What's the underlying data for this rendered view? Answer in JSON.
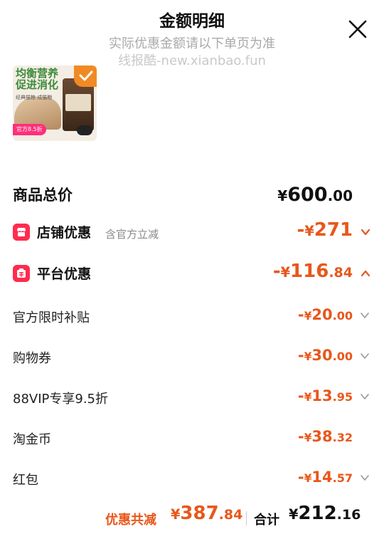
{
  "header": {
    "title": "金额明细",
    "subtitle": "实际优惠金额请以下单页为准",
    "watermark": "线报酷-new.xianbao.fun"
  },
  "product": {
    "image_text": "均衡营养 促进消化",
    "image_small_text": "经典猫粮·成猫粮",
    "badge": "官方8.5折"
  },
  "total": {
    "label": "商品总价",
    "currency": "¥",
    "int": "600",
    "dec": ".00"
  },
  "shop_discount": {
    "label": "店铺优惠",
    "note": "含官方立减",
    "sign": "-",
    "currency": "¥",
    "int": "271",
    "dec": ""
  },
  "platform_discount": {
    "label": "平台优惠",
    "sign": "-",
    "currency": "¥",
    "int": "116",
    "dec": ".84"
  },
  "items": [
    {
      "label": "官方限时补贴",
      "sign": "-",
      "currency": "¥",
      "int": "20",
      "dec": ".00",
      "has_chevron": true
    },
    {
      "label": "购物券",
      "sign": "-",
      "currency": "¥",
      "int": "30",
      "dec": ".00",
      "has_chevron": true
    },
    {
      "label": "88VIP专享9.5折",
      "sign": "-",
      "currency": "¥",
      "int": "13",
      "dec": ".95",
      "has_chevron": true
    },
    {
      "label": "淘金币",
      "sign": "-",
      "currency": "¥",
      "int": "38",
      "dec": ".32",
      "has_chevron": false
    },
    {
      "label": "红包",
      "sign": "-",
      "currency": "¥",
      "int": "14",
      "dec": ".57",
      "has_chevron": true
    }
  ],
  "footer": {
    "discount_label": "优惠共减",
    "discount_currency": "¥",
    "discount_int": "387",
    "discount_dec": ".84",
    "total_label": "合计",
    "total_currency": "¥",
    "total_int": "212",
    "total_dec": ".16"
  },
  "colors": {
    "accent": "#e8571b",
    "icon_red": "#ff2c4f",
    "muted": "#a9a9a9"
  },
  "icons": {
    "close": "close-icon",
    "shop": "shop-icon",
    "platform": "platform-icon",
    "chevron_down": "chevron-down-icon",
    "chevron_up": "chevron-up-icon"
  }
}
